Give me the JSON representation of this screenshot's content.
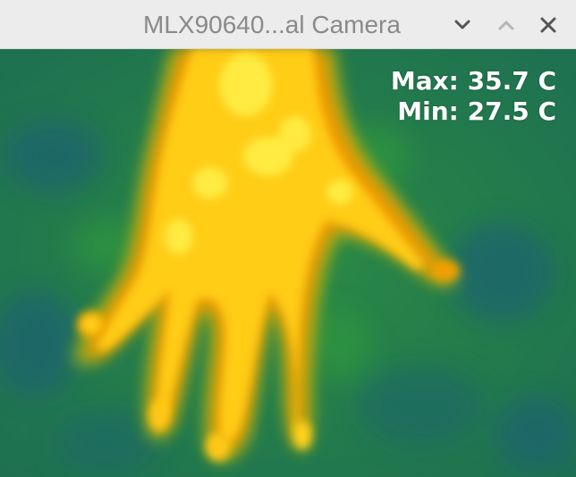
{
  "window": {
    "title": "MLX90640...al Camera",
    "controls": {
      "minimize_icon": "chevron-down-icon",
      "maximize_icon": "chevron-up-icon",
      "close_icon": "close-icon"
    }
  },
  "readout": {
    "max_label": "Max: 35.7 C",
    "min_label": "Min: 27.5 C"
  },
  "colors": {
    "cold_background": "#1f7a4a",
    "cold_speckle": "#1b6a63",
    "warm_edge": "#f29a00",
    "warm_core": "#ffd21a",
    "hot_spot": "#fff14a",
    "titlebar": "#ececec",
    "title_text": "#8a8a8a"
  }
}
